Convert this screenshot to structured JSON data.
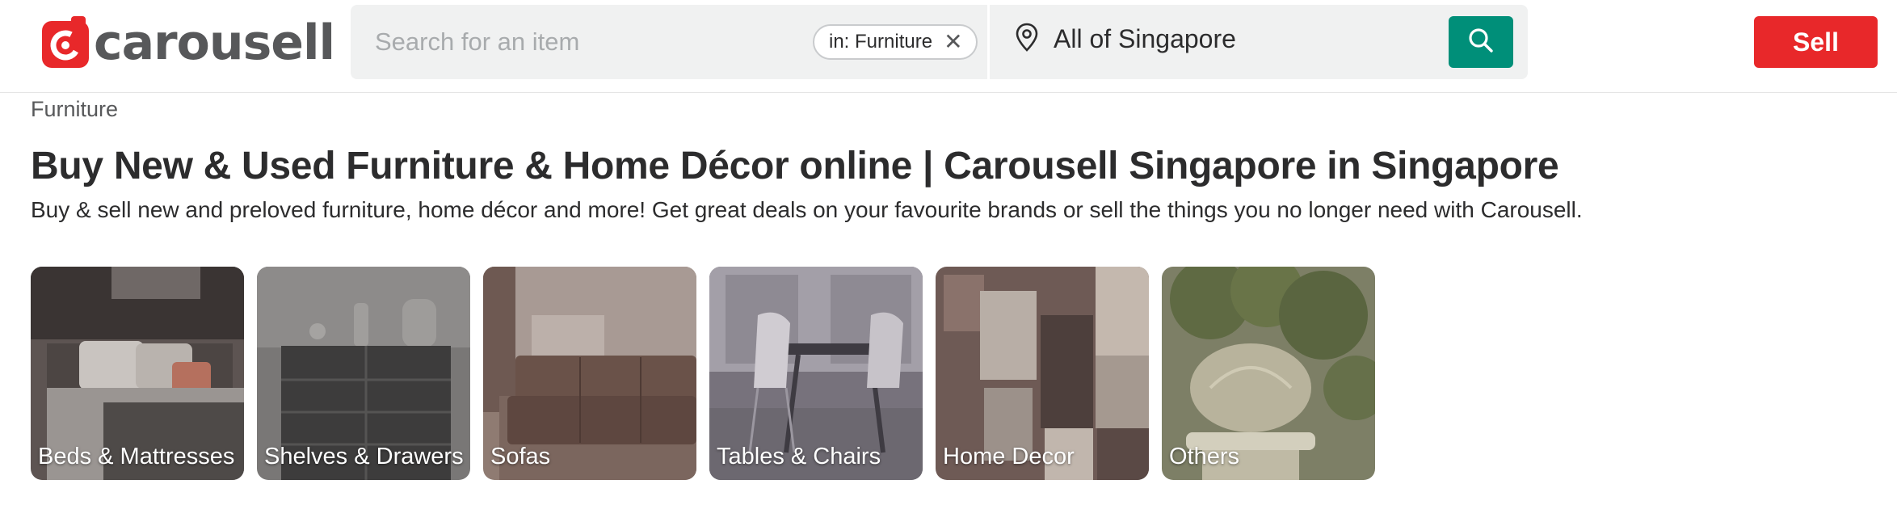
{
  "brand": {
    "name": "carousell",
    "color": "#e8282a"
  },
  "search": {
    "placeholder": "Search for an item",
    "filter_chip": "in: Furniture",
    "location": "All of Singapore",
    "button_color": "#008f79"
  },
  "sell_label": "Sell",
  "breadcrumb": "Furniture",
  "title": "Buy New & Used Furniture & Home Décor online | Carousell Singapore in Singapore",
  "description": "Buy & sell new and preloved furniture, home décor and more! Get great deals on your favourite brands or sell the things you no longer need with Carousell.",
  "categories": [
    {
      "label": "Beds & Mattresses"
    },
    {
      "label": "Shelves & Drawers"
    },
    {
      "label": "Sofas"
    },
    {
      "label": "Tables & Chairs"
    },
    {
      "label": "Home Decor"
    },
    {
      "label": "Others"
    }
  ],
  "icons": {
    "logo": "carousell-logo-icon",
    "chip_close": "close-icon",
    "location": "map-pin-icon",
    "search": "search-icon"
  }
}
